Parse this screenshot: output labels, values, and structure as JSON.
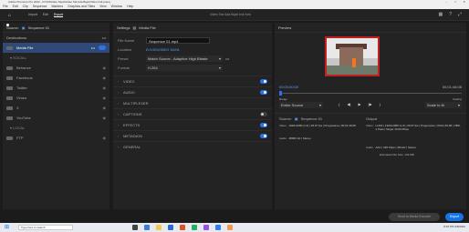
{
  "window": {
    "title": "Adobe Premiere Pro 2022 - D:\\Vid\\Video Saya\\Video Tak Ada Bujet\\Video Indi.prproj"
  },
  "menu": [
    "File",
    "Edit",
    "Clip",
    "Sequence",
    "Markers",
    "Graphics and Titles",
    "View",
    "Window",
    "Help"
  ],
  "header": {
    "tabs": [
      "Import",
      "Edit",
      "Export"
    ],
    "project": "Video Tak Ada Bujet Indi Kek"
  },
  "left": {
    "source_label": "Source:",
    "source_value": "Sequence 01",
    "destinations": "Destinations",
    "items": [
      {
        "label": "Media File",
        "sel": true
      }
    ],
    "social_label": "SOCIAL",
    "social": [
      {
        "label": "Behance"
      },
      {
        "label": "Facebook"
      },
      {
        "label": "Twitter"
      },
      {
        "label": "Vimeo"
      },
      {
        "label": "X"
      },
      {
        "label": "YouTube"
      }
    ],
    "local_label": "LOCAL",
    "local": [
      {
        "label": "FTP"
      }
    ]
  },
  "settings": {
    "title": "Settings",
    "file_label": "Media File",
    "filename_label": "File Name",
    "filename": "Sequence 01.mp4",
    "location_label": "Location",
    "location": "D:\\VID\\VIDEO SAYA",
    "preset_label": "Preset",
    "preset": "Match Source - Adaptive High Bitrate",
    "format_label": "Format",
    "format": "H.264",
    "sections": [
      {
        "label": "VIDEO",
        "on": true
      },
      {
        "label": "AUDIO",
        "on": true
      },
      {
        "label": "MULTIPLEXER",
        "on": null
      },
      {
        "label": "CAPTIONS",
        "on": false
      },
      {
        "label": "EFFECTS",
        "on": true
      },
      {
        "label": "METADATA",
        "on": true
      },
      {
        "label": "GENERAL",
        "on": null
      }
    ]
  },
  "preview": {
    "title": "Preview",
    "timecode_start": "00;00;00;00",
    "timecode_end": "00;01;46;08",
    "range_label": "Range",
    "range": "Entire Source",
    "fit_label": "Scale to fit",
    "scaling_label": "Scaling"
  },
  "summary": {
    "source_label": "Source:",
    "source_value": "Sequence 01",
    "output_label": "Output",
    "video_label": "Video:",
    "video": "1920x1080 (1.0) | 29.97 fps | Progressive | 00;01;46;08",
    "audio_label": "Audio:",
    "audio": "48000 Hz | Stereo",
    "out_video": "H.264 | 1920x1080 (1.0) | 29.97 fps | Progressive | 00;01;46;08 | VBR, 1 Pass | Target 10.00 Mbps",
    "out_audio": "AAC | 320 Kbps | 48 kHz | Stereo",
    "filesize": "Estimated File Size: 133 MB"
  },
  "footer": {
    "queue": "Send to Media Encoder",
    "export": "Export"
  },
  "taskbar": {
    "search": "Type here to search",
    "time": "8:45 PM",
    "date": "4/8/2022"
  },
  "colors": {
    "accent": "#1473e6"
  }
}
